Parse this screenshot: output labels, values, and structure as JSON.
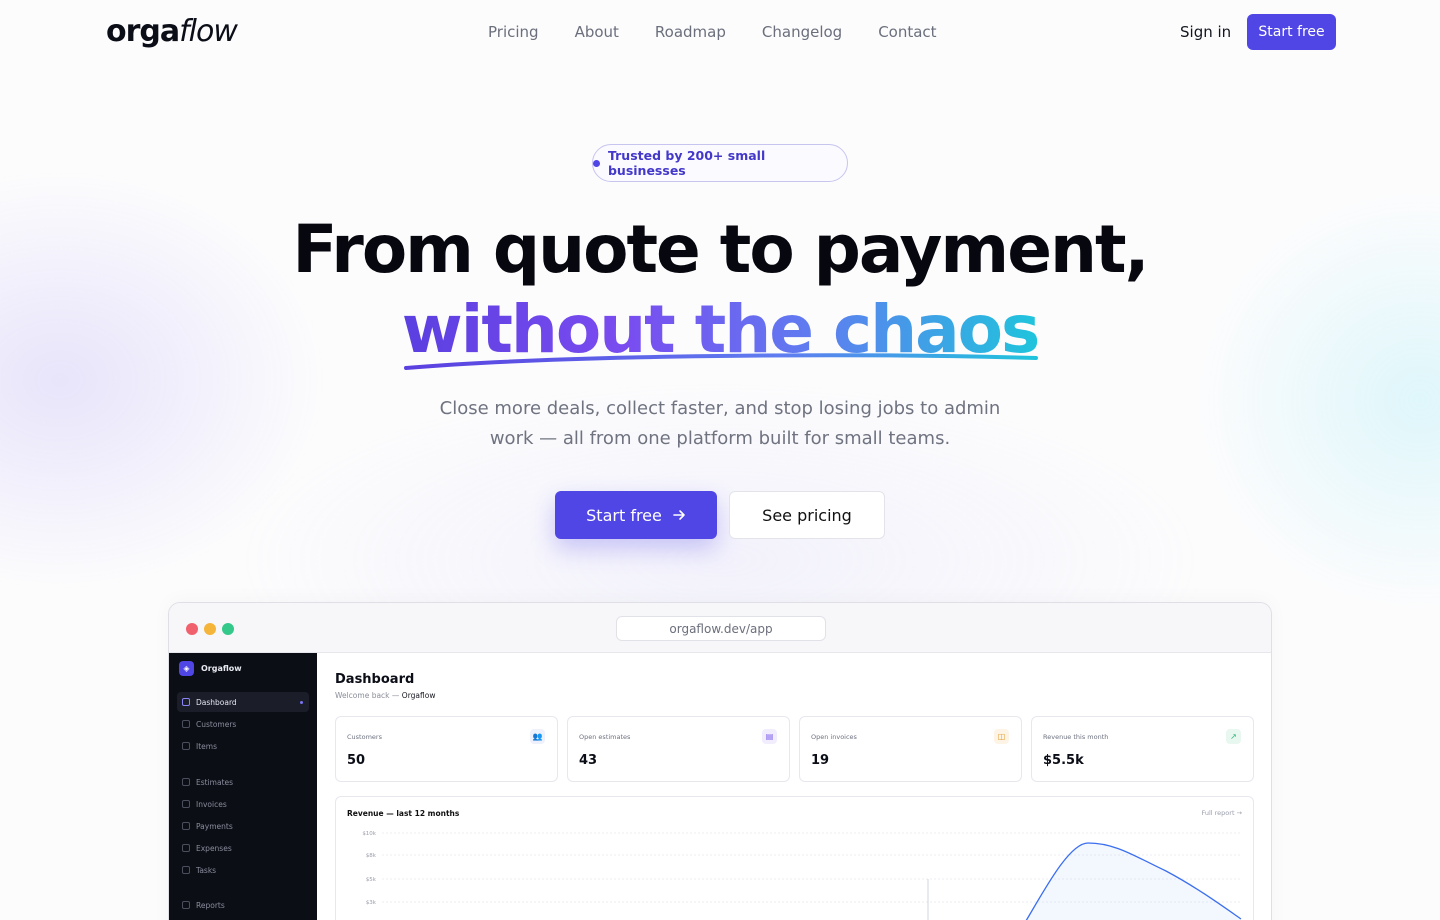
{
  "nav": {
    "logo_bold": "orga",
    "logo_italic": "flow",
    "links": [
      "Pricing",
      "About",
      "Roadmap",
      "Changelog",
      "Contact"
    ],
    "sign_in": "Sign in",
    "start_free": "Start free"
  },
  "hero": {
    "badge": "Trusted by 200+ small businesses",
    "headline_line1": "From quote to payment,",
    "headline_line2": "without the chaos",
    "subtitle": "Close more deals, collect faster, and stop losing jobs to admin work — all from one platform built for small teams.",
    "cta_primary": "Start free",
    "cta_primary_icon": "arrow-right-icon",
    "cta_secondary": "See pricing"
  },
  "app": {
    "url": "orgaflow.dev/app",
    "traffic_lights": [
      "#f0616d",
      "#f5b53a",
      "#34c88a"
    ],
    "sidebar": {
      "brand": "Orgaflow",
      "items": [
        {
          "label": "Dashboard",
          "active": true
        },
        {
          "label": "Customers",
          "active": false
        },
        {
          "label": "Items",
          "active": false
        },
        {
          "label": "Estimates",
          "active": false
        },
        {
          "label": "Invoices",
          "active": false
        },
        {
          "label": "Payments",
          "active": false
        },
        {
          "label": "Expenses",
          "active": false
        },
        {
          "label": "Tasks",
          "active": false
        },
        {
          "label": "Reports",
          "active": false
        }
      ]
    },
    "dashboard": {
      "title": "Dashboard",
      "welcome": "Welcome back —",
      "org": "Orgaflow",
      "cards": [
        {
          "label": "Customers",
          "value": "50",
          "icon": "users-icon",
          "color": "#6b7fd7"
        },
        {
          "label": "Open estimates",
          "value": "43",
          "icon": "document-icon",
          "color": "#7c5bea"
        },
        {
          "label": "Open invoices",
          "value": "19",
          "icon": "invoice-icon",
          "color": "#e39a2a"
        },
        {
          "label": "Revenue this month",
          "value": "$5.5k",
          "icon": "trend-up-icon",
          "color": "#2fb47c"
        }
      ],
      "chart_title": "Revenue — last 12 months",
      "full_report": "Full report →"
    }
  },
  "chart_data": {
    "type": "area",
    "title": "Revenue — last 12 months",
    "y_ticks": [
      "$10k",
      "$8k",
      "$5k",
      "$3k"
    ],
    "visible_points": {
      "rising_to_peak": true,
      "note_visible": "curve peaks near $10k and declines"
    },
    "series": [
      {
        "values": [
          0,
          0,
          0,
          0,
          0,
          0,
          0,
          2.5,
          9.4,
          8.0,
          5.7,
          3.0
        ]
      }
    ],
    "ylim": [
      0,
      10
    ],
    "grid": true,
    "accent": "#3b6ff0"
  },
  "colors": {
    "accent": "#4f46e5"
  }
}
